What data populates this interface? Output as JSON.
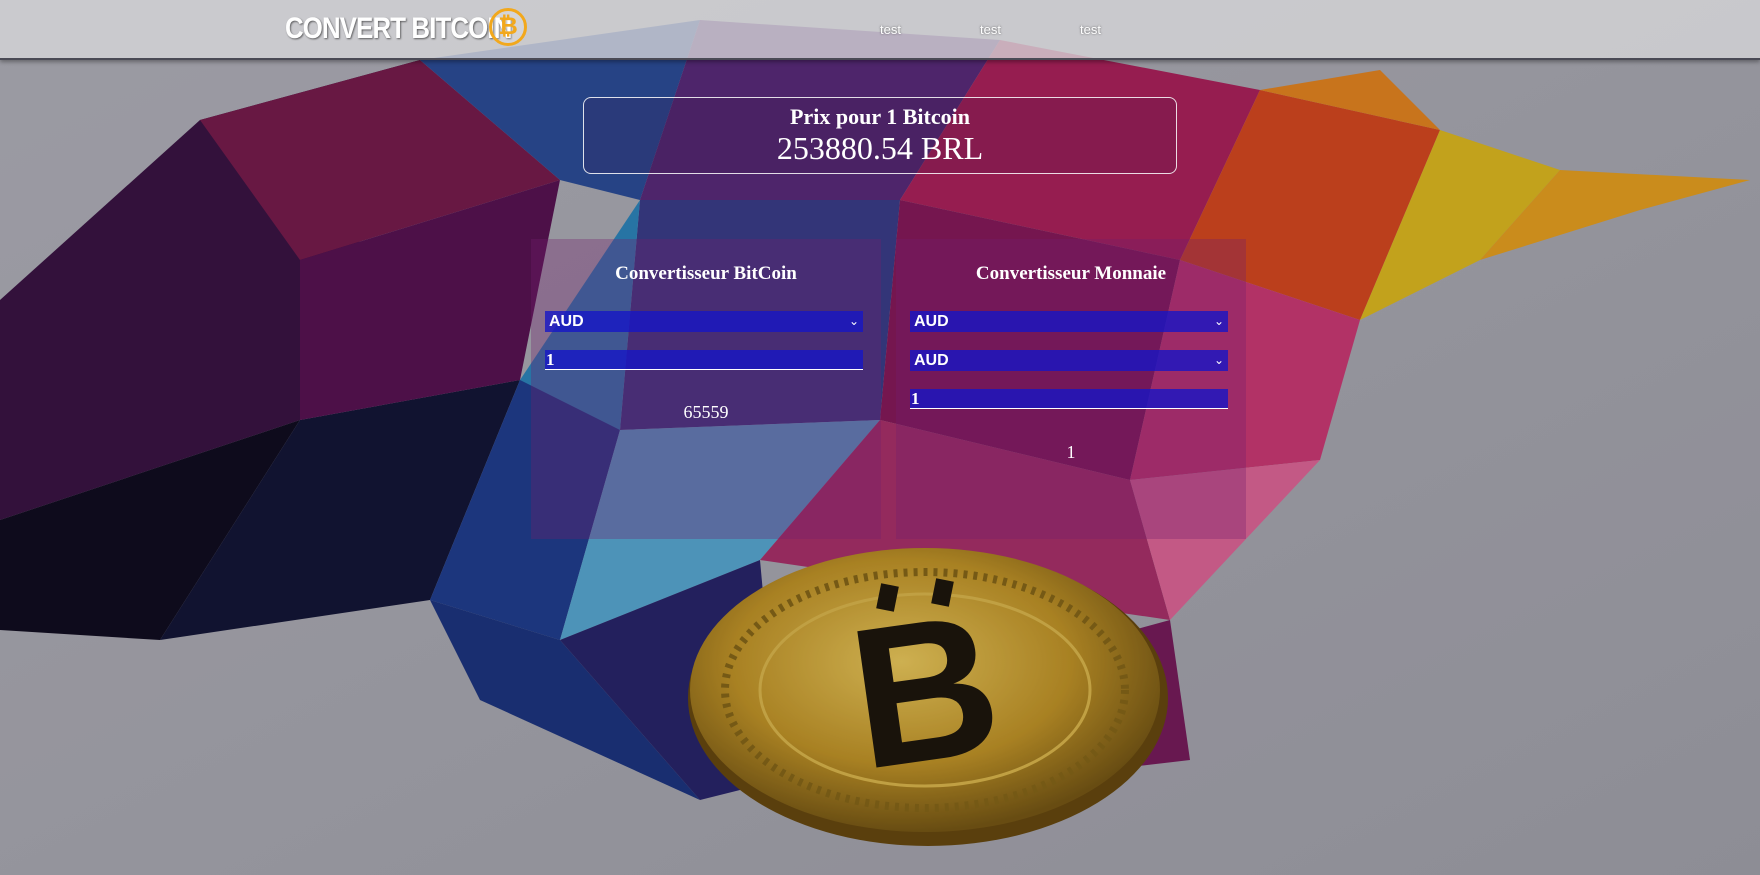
{
  "header": {
    "logo_text": "CONVERT BITCOIN",
    "logo_symbol": "₿",
    "nav": [
      "test",
      "test",
      "test"
    ]
  },
  "price": {
    "label": "Prix pour 1 Bitcoin",
    "value": "253880.54 BRL"
  },
  "bitcoin_converter": {
    "title": "Convertisseur BitCoin",
    "currency": "AUD",
    "amount": "1",
    "result": "65559"
  },
  "currency_converter": {
    "title": "Convertisseur Monnaie",
    "from_currency": "AUD",
    "to_currency": "AUD",
    "amount": "1",
    "result": "1"
  },
  "colors": {
    "coin_accent": "#f2a81c",
    "select_bg": "#1414c8",
    "panel_bg": "#731e6e"
  }
}
